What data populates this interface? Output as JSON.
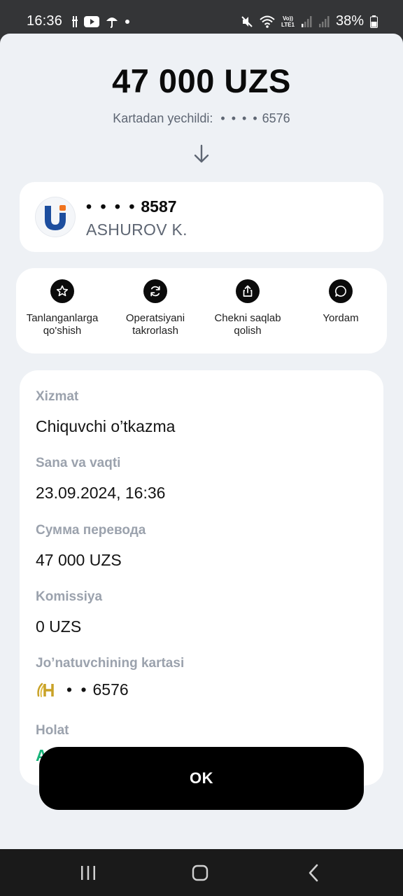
{
  "status_bar": {
    "time": "16:36",
    "battery": "38%",
    "left_icons": [
      "sim-icon",
      "youtube-icon",
      "umbrella-icon",
      "dot-icon"
    ],
    "right_icons": [
      "mute-icon",
      "wifi-icon",
      "volte-icon",
      "signal-icon",
      "signal-icon",
      "battery-icon"
    ],
    "volte_text": "Vo))",
    "lte_text": "LTE1"
  },
  "transfer": {
    "amount": "47 000 UZS",
    "debited_label": "Kartadan yechildi:",
    "debited_mask": "• • • •",
    "debited_card": "6576"
  },
  "recipient": {
    "mask": "• • • •",
    "last4": "8587",
    "name": "ASHUROV K."
  },
  "actions": [
    {
      "label": "Tanlanganlarga\nqo'shish",
      "icon": "star-icon"
    },
    {
      "label": "Operatsiyani\ntakrorlash",
      "icon": "repeat-icon"
    },
    {
      "label": "Chekni saqlab\nqolish",
      "icon": "share-icon"
    },
    {
      "label": "Yordam",
      "icon": "chat-icon"
    }
  ],
  "details": {
    "service_label": "Xizmat",
    "service_value": "Chiquvchi o’tkazma",
    "date_label": "Sana va vaqti",
    "date_value": "23.09.2024, 16:36",
    "sum_label": "Сумма перевода",
    "sum_value": "47 000 UZS",
    "fee_label": "Komissiya",
    "fee_value": "0 UZS",
    "sender_card_label": "Jo’natuvchining kartasi",
    "sender_card_mask": "• •",
    "sender_card_last4": "6576",
    "status_label": "Holat",
    "status_value": "A"
  },
  "ok_button": "OK",
  "colors": {
    "accent_green": "#19b47a",
    "bank_logo_blue": "#1d4e9e",
    "bank_logo_orange": "#f0731e",
    "humo_gold": "#c9a227"
  }
}
